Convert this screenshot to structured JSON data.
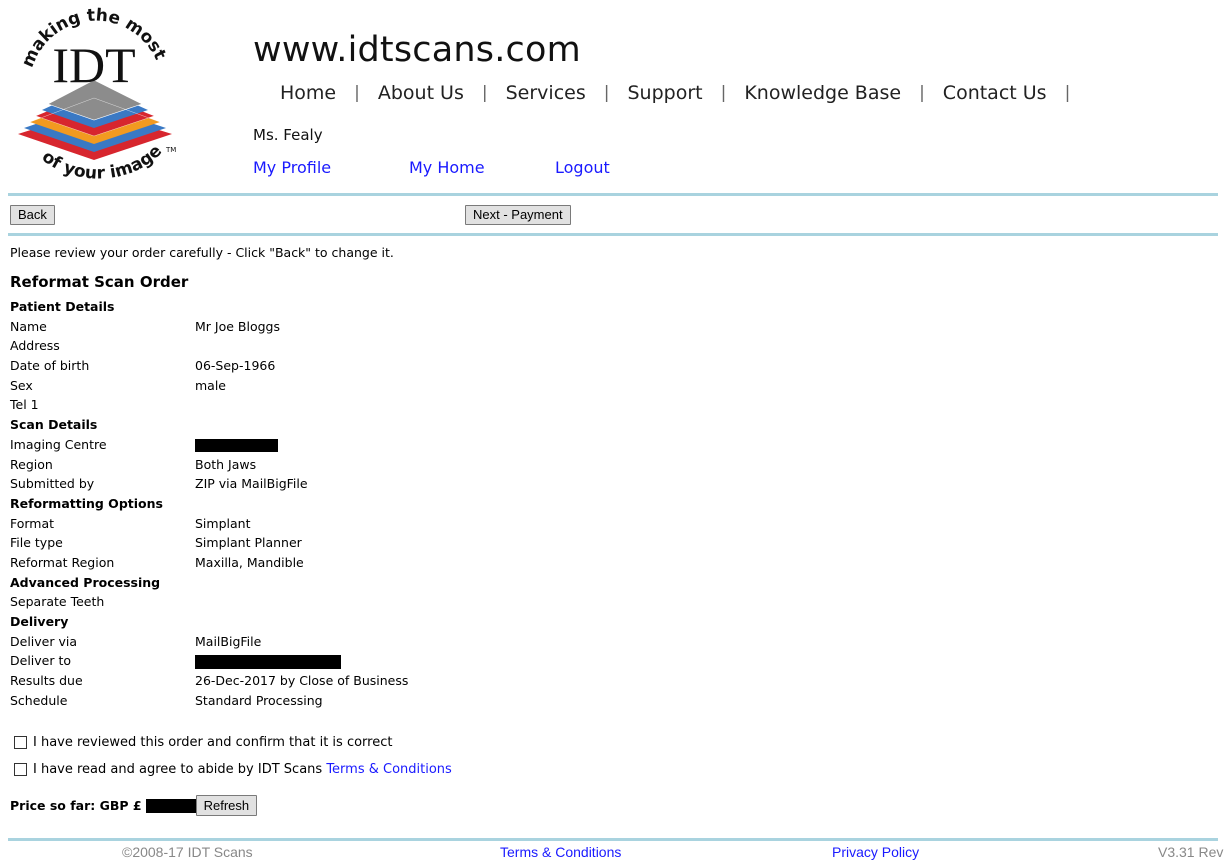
{
  "header": {
    "site_title": "www.idtscans.com",
    "logo": {
      "arc_top": "making the most",
      "center": "IDT",
      "arc_bottom": "of your image",
      "trademark": "TM"
    },
    "nav": [
      {
        "label": "Home"
      },
      {
        "label": "About Us"
      },
      {
        "label": "Services"
      },
      {
        "label": "Support"
      },
      {
        "label": "Knowledge Base"
      },
      {
        "label": "Contact Us"
      }
    ],
    "nav_separator": "|",
    "user_name": "Ms. Fealy",
    "user_links": {
      "profile": "My Profile",
      "home": "My Home",
      "logout": "Logout"
    }
  },
  "toolbar": {
    "back_label": "Back",
    "next_label": "Next - Payment"
  },
  "notice": "Please review your order carefully - Click \"Back\" to change it.",
  "order": {
    "title": "Reformat Scan Order",
    "patient_header": "Patient Details",
    "name_label": "Name",
    "name_value": "Mr Joe Bloggs",
    "address_label": "Address",
    "dob_label": "Date of birth",
    "dob_value": "06-Sep-1966",
    "sex_label": "Sex",
    "sex_value": "male",
    "tel_label": "Tel 1",
    "scan_header": "Scan Details",
    "centre_label": "Imaging Centre",
    "region_label": "Region",
    "region_value": "Both Jaws",
    "submitted_label": "Submitted by",
    "submitted_value": "ZIP via MailBigFile",
    "reformat_header": "Reformatting Options",
    "format_label": "Format",
    "format_value": "Simplant",
    "filetype_label": "File type",
    "filetype_value": "Simplant Planner",
    "reformat_region_label": "Reformat Region",
    "reformat_region_value": "Maxilla, Mandible",
    "advanced_header": "Advanced Processing",
    "separate_label": "Separate Teeth",
    "delivery_header": "Delivery",
    "deliver_via_label": "Deliver via",
    "deliver_via_value": "MailBigFile",
    "deliver_to_label": "Deliver to",
    "results_label": "Results due",
    "results_value": "26-Dec-2017 by Close of Business",
    "schedule_label": "Schedule",
    "schedule_value": "Standard Processing"
  },
  "confirm": {
    "reviewed_label": "I have reviewed this order and confirm that it is correct",
    "reviewed_checked": false,
    "terms_prefix": "I have read and agree to abide by IDT Scans ",
    "terms_link": "Terms & Conditions",
    "terms_checked": false
  },
  "price": {
    "label": "Price so far: GBP £",
    "refresh_label": "Refresh"
  },
  "footer": {
    "copyright": "©2008-17 IDT Scans",
    "terms": "Terms & Conditions",
    "privacy": "Privacy Policy",
    "version": "V3.31 Rev"
  },
  "colors": {
    "link": "#1a1aff",
    "rule": "#a9d3df",
    "logo_red": "#d7262e",
    "logo_orange": "#f29a20",
    "logo_blue": "#3a79c4",
    "logo_gray": "#8c8c8c"
  }
}
